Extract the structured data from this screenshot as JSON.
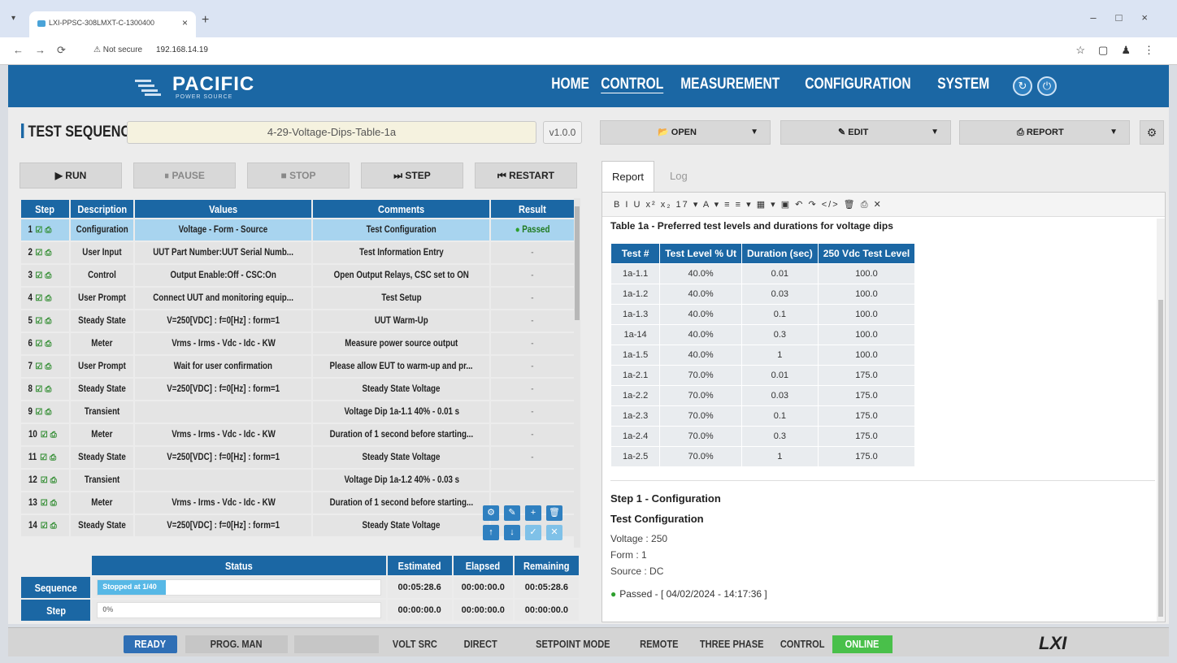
{
  "browser": {
    "tab_title": "LXI-PPSC-308LMXT-C-1300400",
    "security": "Not secure",
    "url": "192.168.14.19"
  },
  "header": {
    "brand": "PACIFIC",
    "brand_sub": "POWER SOURCE",
    "nav": [
      "HOME",
      "CONTROL",
      "MEASUREMENT",
      "CONFIGURATION",
      "SYSTEM"
    ],
    "active_nav": "CONTROL"
  },
  "sequence": {
    "title": "TEST SEQUENCE",
    "name": "4-29-Voltage-Dips-Table-1a",
    "version": "v1.0.0",
    "buttons": {
      "run": "RUN",
      "pause": "PAUSE",
      "stop": "STOP",
      "step": "STEP",
      "restart": "RESTART"
    },
    "columns": [
      "Step",
      "Description",
      "Values",
      "Comments",
      "Result"
    ],
    "rows": [
      {
        "step": "1",
        "description": "Configuration",
        "values": "Voltage - Form - Source",
        "comments": "Test Configuration",
        "result": "Passed"
      },
      {
        "step": "2",
        "description": "User Input",
        "values": "UUT Part Number:UUT Serial Numb...",
        "comments": "Test Information Entry",
        "result": "-"
      },
      {
        "step": "3",
        "description": "Control",
        "values": "Output Enable:Off - CSC:On",
        "comments": "Open Output Relays, CSC set to ON",
        "result": "-"
      },
      {
        "step": "4",
        "description": "User Prompt",
        "values": "Connect UUT and monitoring equip...",
        "comments": "Test Setup",
        "result": "-"
      },
      {
        "step": "5",
        "description": "Steady State",
        "values": "V=250[VDC] : f=0[Hz] : form=1",
        "comments": "UUT Warm-Up",
        "result": "-"
      },
      {
        "step": "6",
        "description": "Meter",
        "values": "Vrms - Irms - Vdc - Idc - KW",
        "comments": "Measure power source output",
        "result": "-"
      },
      {
        "step": "7",
        "description": "User Prompt",
        "values": "Wait for user confirmation",
        "comments": "Please allow EUT to warm-up and pr...",
        "result": "-"
      },
      {
        "step": "8",
        "description": "Steady State",
        "values": "V=250[VDC] : f=0[Hz] : form=1",
        "comments": "Steady State Voltage",
        "result": "-"
      },
      {
        "step": "9",
        "description": "Transient",
        "values": "",
        "comments": "Voltage Dip 1a-1.1 40% - 0.01 s",
        "result": "-"
      },
      {
        "step": "10",
        "description": "Meter",
        "values": "Vrms - Irms - Vdc - Idc - KW",
        "comments": "Duration of 1 second before starting...",
        "result": "-"
      },
      {
        "step": "11",
        "description": "Steady State",
        "values": "V=250[VDC] : f=0[Hz] : form=1",
        "comments": "Steady State Voltage",
        "result": "-"
      },
      {
        "step": "12",
        "description": "Transient",
        "values": "",
        "comments": "Voltage Dip 1a-1.2 40% - 0.03 s",
        "result": ""
      },
      {
        "step": "13",
        "description": "Meter",
        "values": "Vrms - Irms - Vdc - Idc - KW",
        "comments": "Duration of 1 second before starting...",
        "result": ""
      },
      {
        "step": "14",
        "description": "Steady State",
        "values": "V=250[VDC] : f=0[Hz] : form=1",
        "comments": "Steady State Voltage",
        "result": ""
      }
    ],
    "status": {
      "columns": [
        "Status",
        "Estimated",
        "Elapsed",
        "Remaining"
      ],
      "sequence_label": "Sequence",
      "sequence_status": "Stopped at 1/40",
      "sequence_progress": 0.025,
      "sequence_estimated": "00:05:28.6",
      "sequence_elapsed": "00:00:00.0",
      "sequence_remaining": "00:05:28.6",
      "step_label": "Step",
      "step_status": "0%",
      "step_progress": 0,
      "step_estimated": "00:00:00.0",
      "step_elapsed": "00:00:00.0",
      "step_remaining": "00:00:00.0"
    }
  },
  "right": {
    "open": "OPEN",
    "edit": "EDIT",
    "report": "REPORT",
    "tabs": [
      "Report",
      "Log"
    ],
    "toolbar": "B I U x² x₂ 17 ▾ A ▾ ≡ ≡ ▾ ▦ ▾ ▣ ↶ ↷ </> 🗑 ⎙ ✕",
    "report_caption": "Table 1a - Preferred test levels and durations for voltage dips",
    "report_columns": [
      "Test #",
      "Test Level % Ut",
      "Duration (sec)",
      "250 Vdc Test Level"
    ],
    "report_rows": [
      [
        "1a-1.1",
        "40.0%",
        "0.01",
        "100.0"
      ],
      [
        "1a-1.2",
        "40.0%",
        "0.03",
        "100.0"
      ],
      [
        "1a-1.3",
        "40.0%",
        "0.1",
        "100.0"
      ],
      [
        "1a-14",
        "40.0%",
        "0.3",
        "100.0"
      ],
      [
        "1a-1.5",
        "40.0%",
        "1",
        "100.0"
      ],
      [
        "1a-2.1",
        "70.0%",
        "0.01",
        "175.0"
      ],
      [
        "1a-2.2",
        "70.0%",
        "0.03",
        "175.0"
      ],
      [
        "1a-2.3",
        "70.0%",
        "0.1",
        "175.0"
      ],
      [
        "1a-2.4",
        "70.0%",
        "0.3",
        "175.0"
      ],
      [
        "1a-2.5",
        "70.0%",
        "1",
        "175.0"
      ]
    ],
    "step_heading": "Step 1 - Configuration",
    "step_sub": "Test Configuration",
    "step_details": [
      "Voltage : 250",
      "Form : 1",
      "Source : DC"
    ],
    "step_result": "Passed - [ 04/02/2024 - 14:17:36 ]"
  },
  "statusbar": {
    "ready": "READY",
    "prog": "PROG. MAN",
    "volt": "VOLT SRC",
    "direct": "DIRECT",
    "setpoint": "SETPOINT MODE",
    "remote": "REMOTE",
    "phase": "THREE PHASE",
    "control": "CONTROL",
    "online": "ONLINE",
    "logo": "LXI"
  }
}
